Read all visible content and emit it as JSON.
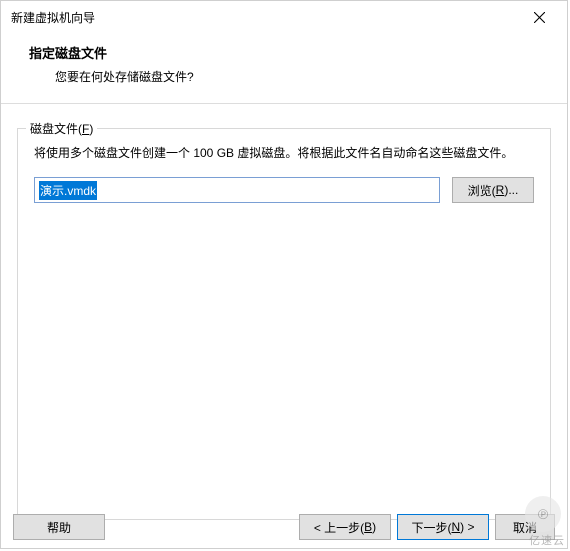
{
  "window": {
    "title": "新建虚拟机向导"
  },
  "header": {
    "title": "指定磁盘文件",
    "subtitle": "您要在何处存储磁盘文件?"
  },
  "fieldset": {
    "legend_prefix": "磁盘文件(",
    "legend_key": "F",
    "legend_suffix": ")",
    "description": "将使用多个磁盘文件创建一个 100 GB 虚拟磁盘。将根据此文件名自动命名这些磁盘文件。",
    "file_value": "演示.vmdk",
    "browse_prefix": "浏览(",
    "browse_key": "R",
    "browse_suffix": ")..."
  },
  "footer": {
    "help": "帮助",
    "back_prefix": "< 上一步(",
    "back_key": "B",
    "back_suffix": ")",
    "next_prefix": "下一步(",
    "next_key": "N",
    "next_suffix": ") >",
    "cancel": "取消"
  },
  "watermark": {
    "icon": "℗",
    "text": "亿速云"
  }
}
